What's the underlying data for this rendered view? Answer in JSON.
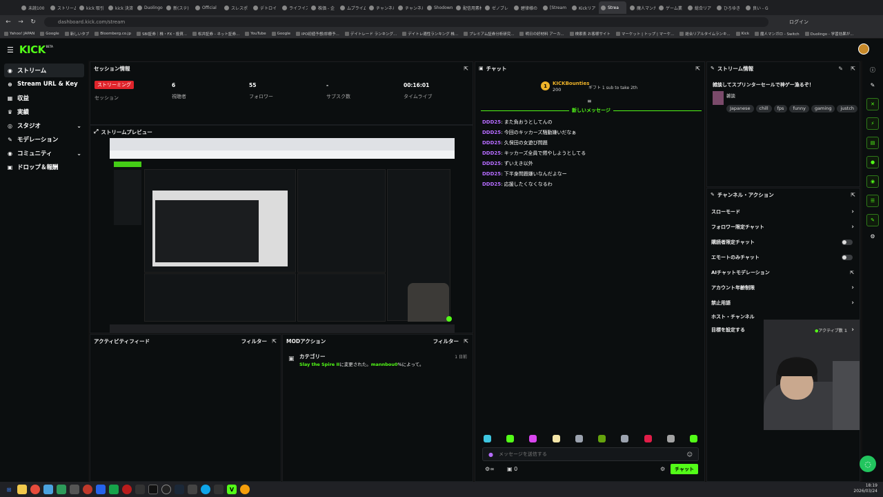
{
  "browser": {
    "tabs": [
      "未読100",
      "ストリーム",
      "kick 取引",
      "kick 決済",
      "Duolingo",
      "新(ステ)",
      "Official",
      "スレスポ",
      "デトロイ",
      "ライフイズ",
      "株価 - 企",
      "ムプライム",
      "チャンネル",
      "チャンネル",
      "Shodown",
      "配信用素材",
      "ゼノブレ",
      "碧律様の",
      "[Stream",
      "Kickリア",
      "Strea",
      "魔人マンガ",
      "ゲーム業",
      "総合リア",
      "ひろゆき",
      "良い - G"
    ],
    "active_tab_index": 20,
    "url": "dashboard.kick.com/stream",
    "login_label": "ログイン",
    "bookmarks": [
      "Yahoo! JAPAN",
      "Google",
      "新しいタブ",
      "Bloomberg.co.jp",
      "SBI証券｜株・FX・投資...",
      "松井証券 - ネット証券...",
      "YouTube",
      "Google",
      "IPO初値予想/診療予...",
      "デイトレード ランキング...",
      "デイトレ適性ランキング 株...",
      "プレミアム証券分析研究...",
      "明日の好材料 アーカ...",
      "検索表 お客様サイト",
      "マーケット | トップ | マーケ...",
      "総合リアルタイムランキ...",
      "Kick",
      "魔人マンガロ - Switch",
      "Duolingo - 学習効果が..."
    ]
  },
  "app": {
    "logo": "KICK",
    "logo_badge": "BETA"
  },
  "sidebar": {
    "items": [
      {
        "label": "ストリーム",
        "icon": "broadcast-icon"
      },
      {
        "label": "Stream URL & Key",
        "icon": "link-icon"
      },
      {
        "label": "収益",
        "icon": "revenue-icon"
      },
      {
        "label": "実績",
        "icon": "trophy-icon"
      },
      {
        "label": "スタジオ",
        "icon": "camera-icon"
      },
      {
        "label": "モデレーション",
        "icon": "hammer-icon"
      },
      {
        "label": "コミュニティ",
        "icon": "people-icon"
      },
      {
        "label": "ドロップ＆報酬",
        "icon": "gift-icon"
      }
    ]
  },
  "session": {
    "title": "セッション情報",
    "status_badge": "ストリーミング",
    "session_label": "セッション",
    "stats": [
      {
        "value": "6",
        "label": "視聴者"
      },
      {
        "value": "55",
        "label": "フォロワー"
      },
      {
        "value": "-",
        "label": "サブスク数"
      },
      {
        "value": "00:16:01",
        "label": "タイムライブ"
      }
    ]
  },
  "preview": {
    "title": "ストリームプレビュー"
  },
  "activity": {
    "title": "アクティビティフィード",
    "filter": "フィルター"
  },
  "mod": {
    "title": "MODアクション",
    "filter": "フィルター",
    "item_title": "カテゴリー",
    "item_time": "1 日前",
    "item_game": "Slay the Spire II",
    "item_text": "に変更された。",
    "item_user": "mannbou0",
    "item_suffix": "%によって。"
  },
  "chat": {
    "title": "チャット",
    "bounty_name": "KICKBounties",
    "bounty_amount": "200",
    "bounty_desc": "ギフト 1 sub to take 2th",
    "new_messages": "新しいメッセージ",
    "messages": [
      {
        "user": "DDD25",
        "text": "また負おうとしてんの"
      },
      {
        "user": "DDD25",
        "text": "今回のキッカーズ騒動嫌いだなぁ"
      },
      {
        "user": "DDD25",
        "text": "久保田の女遊び問題"
      },
      {
        "user": "DDD25",
        "text": "キッカーズ全員で燃やしようとしてる"
      },
      {
        "user": "DDD25",
        "text": "ずいえき以外"
      },
      {
        "user": "DDD25",
        "text": "下半身問題嫌いなんだよなー"
      },
      {
        "user": "DDD25",
        "text": "応援したくなくなるわ"
      }
    ],
    "input_placeholder": "メッセージを送信する",
    "count": "0",
    "send_label": "チャット"
  },
  "stream_info": {
    "title": "ストリーム情報",
    "stream_title": "雑談してスプリンターセールで神ゲー漁るぞ！",
    "category": "雑談",
    "tags": [
      "Japanese",
      "chill",
      "fps",
      "funny",
      "gaming",
      "justch"
    ]
  },
  "channel_actions": {
    "title": "チャンネル・アクション",
    "items": [
      {
        "label": "スローモード",
        "type": "chevron"
      },
      {
        "label": "フォロワー限定チャット",
        "type": "chevron"
      },
      {
        "label": "購読者限定チャット",
        "type": "toggle"
      },
      {
        "label": "エモートのみチャット",
        "type": "toggle"
      },
      {
        "label": "AIチャットモデレーション",
        "type": "external"
      },
      {
        "label": "アカウント年齢制限",
        "type": "chevron"
      },
      {
        "label": "禁止用語",
        "type": "chevron"
      },
      {
        "label": "ホスト・チャンネル",
        "type": "none"
      },
      {
        "label": "目標を設定する",
        "type": "status",
        "status": "アクティブ数 1"
      }
    ]
  },
  "taskbar": {
    "time": "18:19",
    "date": "2026/03/24"
  },
  "colors": {
    "accent": "#53fc18",
    "live_red": "#e0242b",
    "chat_user": "#b66cff"
  }
}
